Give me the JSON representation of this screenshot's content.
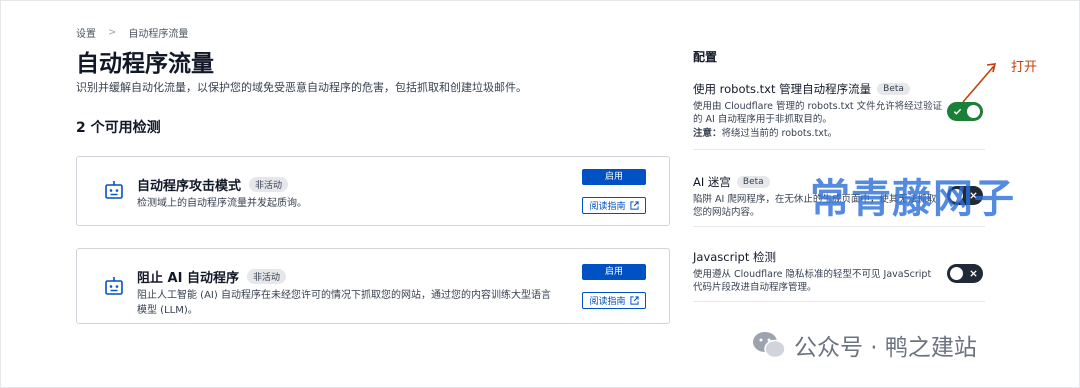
{
  "breadcrumb": {
    "items": [
      "设置",
      "自动程序流量"
    ],
    "separator": ">"
  },
  "page": {
    "title": "自动程序流量",
    "description": "识别并缓解自动化流量，以保护您的域免受恶意自动程序的危害，包括抓取和创建垃圾邮件。"
  },
  "detections": {
    "heading": "2 个可用检测",
    "cards": [
      {
        "title": "自动程序攻击模式",
        "badge": "非活动",
        "description": "检测域上的自动程序流量并发起质询。",
        "enable_label": "启用",
        "guide_label": "阅读指南",
        "icon": "robot-icon"
      },
      {
        "title": "阻止 AI 自动程序",
        "badge": "非活动",
        "description": "阻止人工智能 (AI) 自动程序在未经您许可的情况下抓取您的网站，通过您的内容训练大型语言模型 (LLM)。",
        "enable_label": "启用",
        "guide_label": "阅读指南",
        "icon": "robot-icon"
      }
    ]
  },
  "config": {
    "heading": "配置",
    "items": [
      {
        "name": "使用 robots.txt 管理自动程序流量",
        "badge": "Beta",
        "description": "使用由 Cloudflare 管理的 robots.txt 文件允许将经过验证的 AI 自动程序用于非抓取目的。",
        "note_label": "注意：",
        "note_text": "将绕过当前的 robots.txt。",
        "enabled": true
      },
      {
        "name": "AI 迷宫",
        "badge": "Beta",
        "description": "陷阱 AI 爬网程序，在无休止的生成页面中，使其无法抓取您的网站内容。",
        "enabled": false
      },
      {
        "name": "Javascript 检测",
        "description": "使用遵从 Cloudflare 隐私标准的轻型不可见 JavaScript 代码片段改进自动程序管理。",
        "enabled": false
      }
    ]
  },
  "annotation": {
    "text": "打开",
    "color": "#c2410c"
  },
  "watermarks": {
    "blue": "常青藤网子",
    "gray": "公众号 · 鸭之建站"
  },
  "colors": {
    "primary": "#0051c3",
    "toggle_on": "#1a7f37",
    "toggle_off": "#1f2937"
  }
}
